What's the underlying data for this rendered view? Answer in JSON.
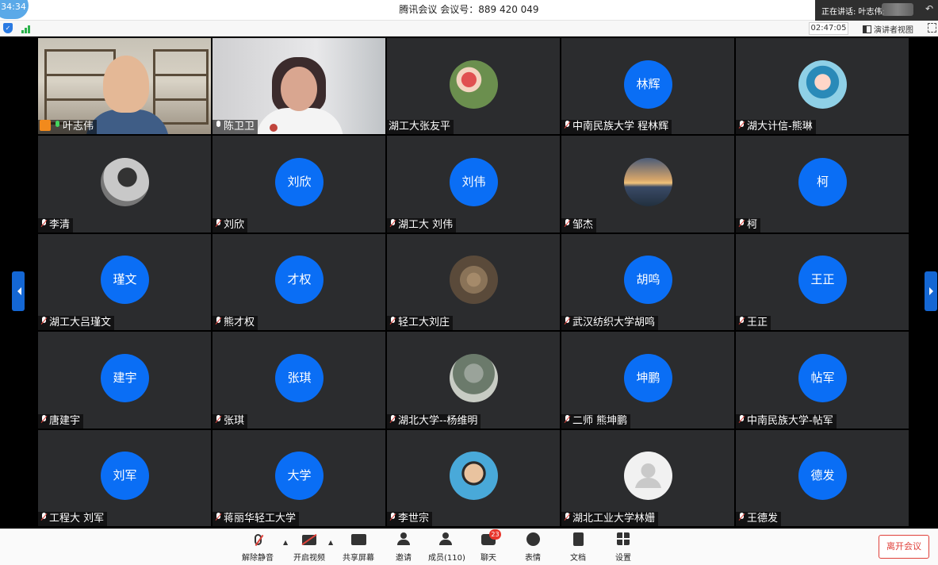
{
  "app": {
    "title": "腾讯会议 会议号：889 420 049",
    "clock": "34:34",
    "speaking_label": "正在讲话: 叶志伟;",
    "elapsed": "02:47:05",
    "view_button": "演讲者视图"
  },
  "participants": [
    {
      "name": "叶志伟",
      "mic": "on",
      "kind": "video1",
      "host": true,
      "active": true
    },
    {
      "name": "陈卫卫",
      "mic": "plain",
      "kind": "video2"
    },
    {
      "name": "湖工大张友平",
      "mic": "none",
      "kind": "photo",
      "avatar": ""
    },
    {
      "name": "中南民族大学 程林辉",
      "mic": "muted",
      "kind": "text",
      "avatar": "林辉"
    },
    {
      "name": "湖大计信-熊琳",
      "mic": "muted",
      "kind": "photo",
      "avatar": ""
    },
    {
      "name": "李清",
      "mic": "muted",
      "kind": "photo",
      "avatar": ""
    },
    {
      "name": "刘欣",
      "mic": "muted",
      "kind": "text",
      "avatar": "刘欣"
    },
    {
      "name": "湖工大 刘伟",
      "mic": "muted",
      "kind": "text",
      "avatar": "刘伟"
    },
    {
      "name": "邹杰",
      "mic": "muted",
      "kind": "photo",
      "avatar": ""
    },
    {
      "name": "柯",
      "mic": "muted",
      "kind": "text",
      "avatar": "柯"
    },
    {
      "name": "湖工大吕瑾文",
      "mic": "muted",
      "kind": "text",
      "avatar": "瑾文"
    },
    {
      "name": "熊才权",
      "mic": "muted",
      "kind": "text",
      "avatar": "才权"
    },
    {
      "name": "轻工大刘庄",
      "mic": "muted",
      "kind": "photo",
      "avatar": ""
    },
    {
      "name": "武汉纺织大学胡鸣",
      "mic": "muted",
      "kind": "text",
      "avatar": "胡鸣"
    },
    {
      "name": "王正",
      "mic": "muted",
      "kind": "text",
      "avatar": "王正"
    },
    {
      "name": "唐建宇",
      "mic": "muted",
      "kind": "text",
      "avatar": "建宇"
    },
    {
      "name": "张琪",
      "mic": "muted",
      "kind": "text",
      "avatar": "张琪"
    },
    {
      "name": "湖北大学--杨维明",
      "mic": "muted",
      "kind": "photo",
      "avatar": ""
    },
    {
      "name": "二师 熊坤鹏",
      "mic": "muted",
      "kind": "text",
      "avatar": "坤鹏"
    },
    {
      "name": "中南民族大学-帖军",
      "mic": "muted",
      "kind": "text",
      "avatar": "帖军"
    },
    {
      "name": "工程大 刘军",
      "mic": "muted",
      "kind": "text",
      "avatar": "刘军"
    },
    {
      "name": "蒋丽华轻工大学",
      "mic": "muted",
      "kind": "text",
      "avatar": "大学"
    },
    {
      "name": "李世宗",
      "mic": "muted",
      "kind": "photo",
      "avatar": ""
    },
    {
      "name": "湖北工业大学林姗",
      "mic": "muted",
      "kind": "default",
      "avatar": ""
    },
    {
      "name": "王德发",
      "mic": "muted",
      "kind": "text",
      "avatar": "德发"
    }
  ],
  "toolbar": {
    "unmute": "解除静音",
    "start_video": "开启视频",
    "share_screen": "共享屏幕",
    "invite": "邀请",
    "members": "成员(110)",
    "chat": "聊天",
    "chat_badge": "23",
    "reactions": "表情",
    "docs": "文档",
    "settings": "设置",
    "leave": "离开会议"
  },
  "colors": {
    "avatar_blue": "#0a6ef5",
    "tile_bg": "#2b2c2e",
    "active_border": "#3fbf6a",
    "leave_red": "#e0403a"
  }
}
